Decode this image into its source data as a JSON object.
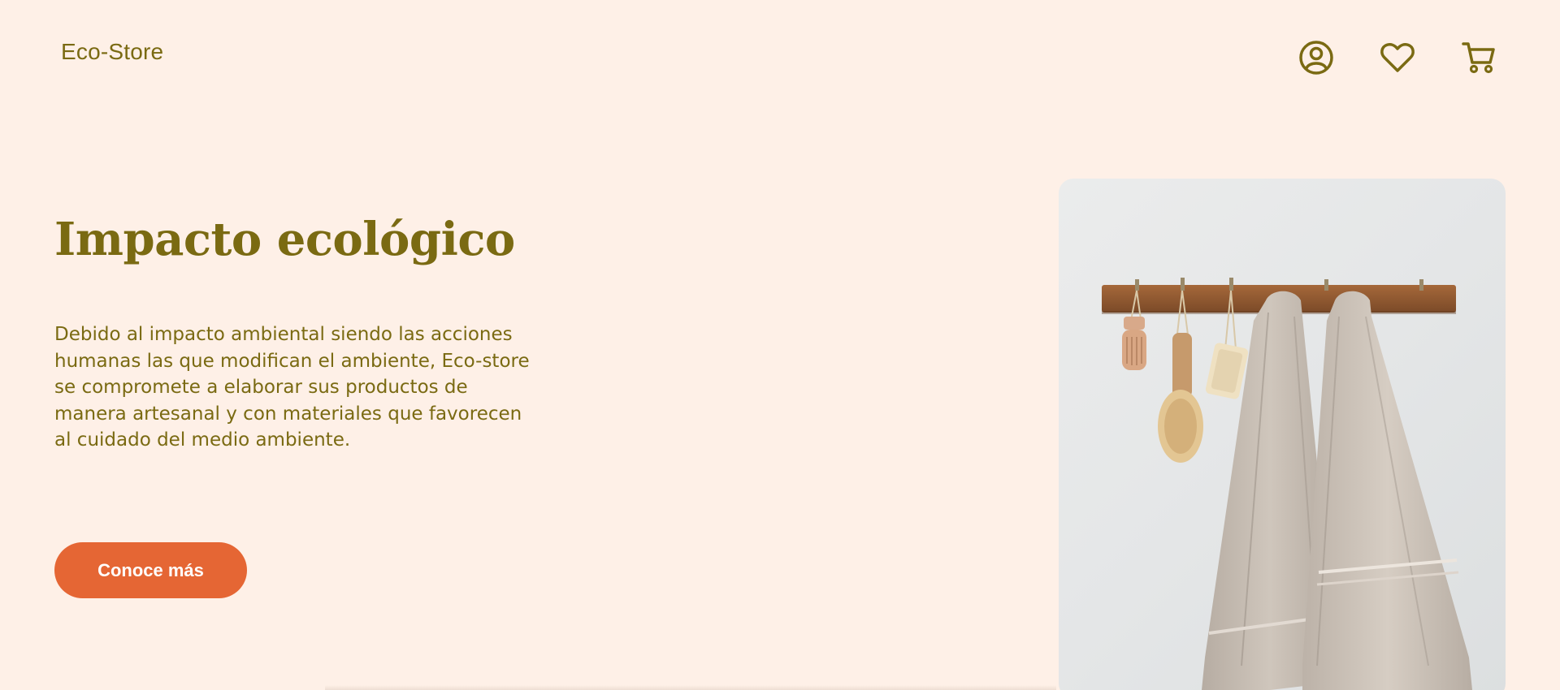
{
  "header": {
    "brand": "Eco-Store",
    "icons": [
      "user-profile-icon",
      "heart-icon",
      "shopping-cart-icon"
    ]
  },
  "hero": {
    "title": "Impacto ecológico",
    "description": "Debido al impacto ambiental siendo las acciones humanas las que modifican el ambiente, Eco-store se compromete a elaborar sus productos de manera artesanal y con materiales que favorecen al cuidado del medio ambiente.",
    "cta_label": "Conoce más"
  },
  "colors": {
    "background": "#fef0e7",
    "text": "#7a6a12",
    "accent": "#e56634"
  }
}
